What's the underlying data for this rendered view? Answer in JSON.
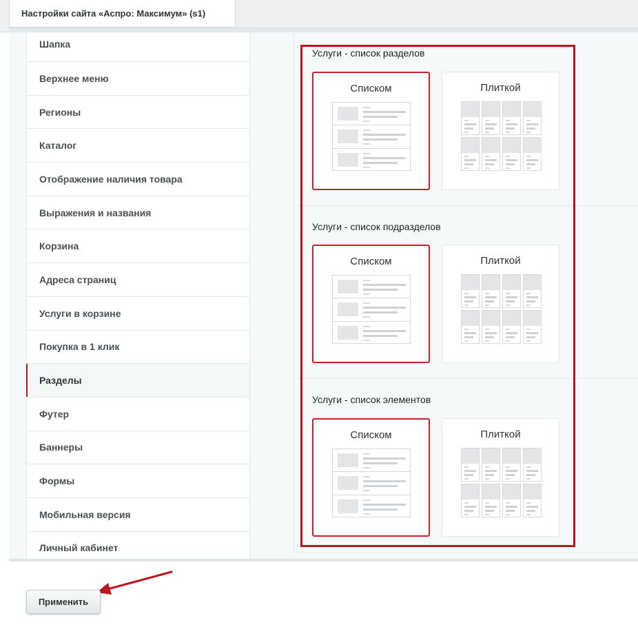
{
  "tab": {
    "title": "Настройки сайта «Аспро: Максимум» (s1)"
  },
  "sidebar": {
    "items": [
      {
        "label": "Шапка"
      },
      {
        "label": "Верхнее меню"
      },
      {
        "label": "Регионы"
      },
      {
        "label": "Каталог"
      },
      {
        "label": "Отображение наличия товара"
      },
      {
        "label": "Выражения и названия"
      },
      {
        "label": "Корзина"
      },
      {
        "label": "Адреса страниц"
      },
      {
        "label": "Услуги в корзине"
      },
      {
        "label": "Покупка в 1 клик"
      },
      {
        "label": "Разделы",
        "active": true
      },
      {
        "label": "Футер"
      },
      {
        "label": "Баннеры"
      },
      {
        "label": "Формы"
      },
      {
        "label": "Мобильная версия"
      },
      {
        "label": "Личный кабинет"
      }
    ]
  },
  "sections": [
    {
      "title": "Услуги - список разделов",
      "selected": "list",
      "options": {
        "list": "Списком",
        "tile": "Плиткой"
      }
    },
    {
      "title": "Услуги - список подразделов",
      "selected": "list",
      "options": {
        "list": "Списком",
        "tile": "Плиткой"
      }
    },
    {
      "title": "Услуги - список элементов",
      "selected": "list",
      "options": {
        "list": "Списком",
        "tile": "Плиткой"
      }
    }
  ],
  "footer": {
    "apply_label": "Применить"
  },
  "colors": {
    "accent": "#c4232b",
    "highlight": "#b71519",
    "active_marker": "#b41a1f"
  }
}
